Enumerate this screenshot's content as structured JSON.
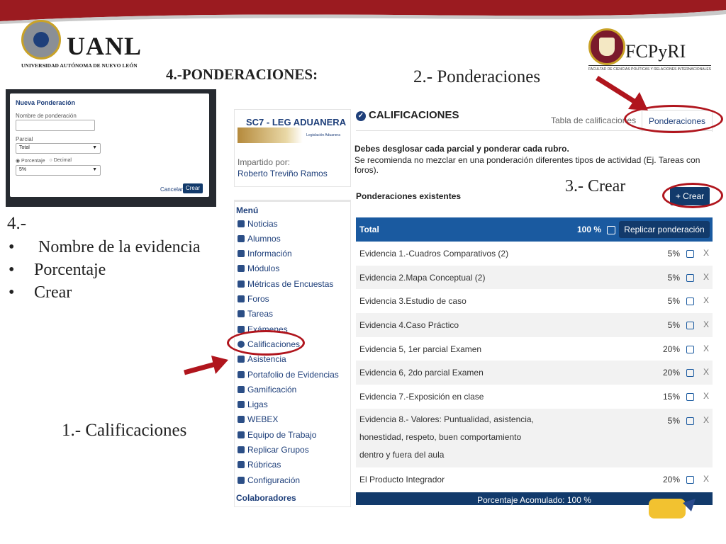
{
  "header": {
    "uanl_name": "UANL",
    "uanl_subtitle": "UNIVERSIDAD AUTÓNOMA DE NUEVO LEÓN",
    "fcp_name": "FCPyRI",
    "fcp_subtitle": "FACULTAD DE CIENCIAS POLÍTICAS Y RELACIONES INTERNACIONALES"
  },
  "slide": {
    "title": "4.-PONDERACIONES:",
    "step2": "2.- Ponderaciones",
    "step3": "3.- Crear",
    "step1": "1.- Calificaciones",
    "step4_heading": "4.-",
    "step4_bullet": "•",
    "step4_items": [
      "Nombre de la evidencia",
      "Porcentaje",
      "Crear"
    ]
  },
  "dialog": {
    "title": "Nueva Ponderación",
    "name_label": "Nombre de ponderación",
    "parcial_label": "Parcial",
    "parcial_value": "Total",
    "radio_pct": "◉ Porcentaje",
    "radio_dec": "○ Decimal",
    "pct_value": "5%",
    "cancel_label": "Cancelar",
    "create_label": "Crear"
  },
  "course": {
    "title": "SC7 - LEG ADUANERA",
    "banner_text": "Legislación Aduanera",
    "impartido_label": "Impartido por:",
    "teacher": "Roberto Treviño Ramos"
  },
  "menu": {
    "title": "Menú",
    "items": [
      "Noticias",
      "Alumnos",
      "Información",
      "Módulos",
      "Métricas de Encuestas",
      "Foros",
      "Tareas",
      "Exámenes",
      "Calificaciones",
      "Asistencia",
      "Portafolio de Evidencias",
      "Gamificación",
      "Ligas",
      "WEBEX",
      "Equipo de Trabajo",
      "Replicar Grupos",
      "Rúbricas",
      "Configuración"
    ],
    "collaborators": "Colaboradores"
  },
  "panel": {
    "title": "CALIFICACIONES",
    "tab_tabla": "Tabla de calificaciones",
    "tab_ponder": "Ponderaciones",
    "instruction_bold": "Debes desglosar cada parcial y ponderar cada rubro.",
    "instruction": "Se recomienda no mezclar en una ponderación diferentes tipos de actividad (Ej. Tareas con foros).",
    "existing_label": "Ponderaciones existentes",
    "crear_label": "+ Crear"
  },
  "table": {
    "head_label": "Total",
    "head_pct": "100 %",
    "replicar_label": "Replicar ponderación",
    "delete_glyph": "X",
    "rows": [
      {
        "label": "Evidencia 1.-Cuadros Comparativos (2)",
        "pct": "5%"
      },
      {
        "label": "Evidencia 2.Mapa Conceptual (2)",
        "pct": "5%"
      },
      {
        "label": "Evidencia 3.Estudio de caso",
        "pct": "5%"
      },
      {
        "label": "Evidencia 4.Caso Práctico",
        "pct": "5%"
      },
      {
        "label": "Evidencia 5, 1er parcial Examen",
        "pct": "20%"
      },
      {
        "label": "Evidencia 6, 2do parcial Examen",
        "pct": "20%"
      },
      {
        "label": "Evidencia 7.-Exposición en clase",
        "pct": "15%"
      },
      {
        "label_lines": [
          "Evidencia 8.- Valores: Puntualidad, asistencia,",
          "honestidad, respeto, buen comportamiento",
          "dentro y fuera del aula"
        ],
        "pct": "5%"
      },
      {
        "label": "El Producto Integrador",
        "pct": "20%"
      }
    ],
    "footer": "Porcentaje Acomulado: 100 %"
  },
  "colors": {
    "top_band": "#9b1b20",
    "navy": "#123a6b",
    "table_header": "#1a5aa0",
    "annotation_red": "#b0151d"
  },
  "icons": {
    "edit": "edit-icon",
    "check": "check-circle-icon"
  }
}
